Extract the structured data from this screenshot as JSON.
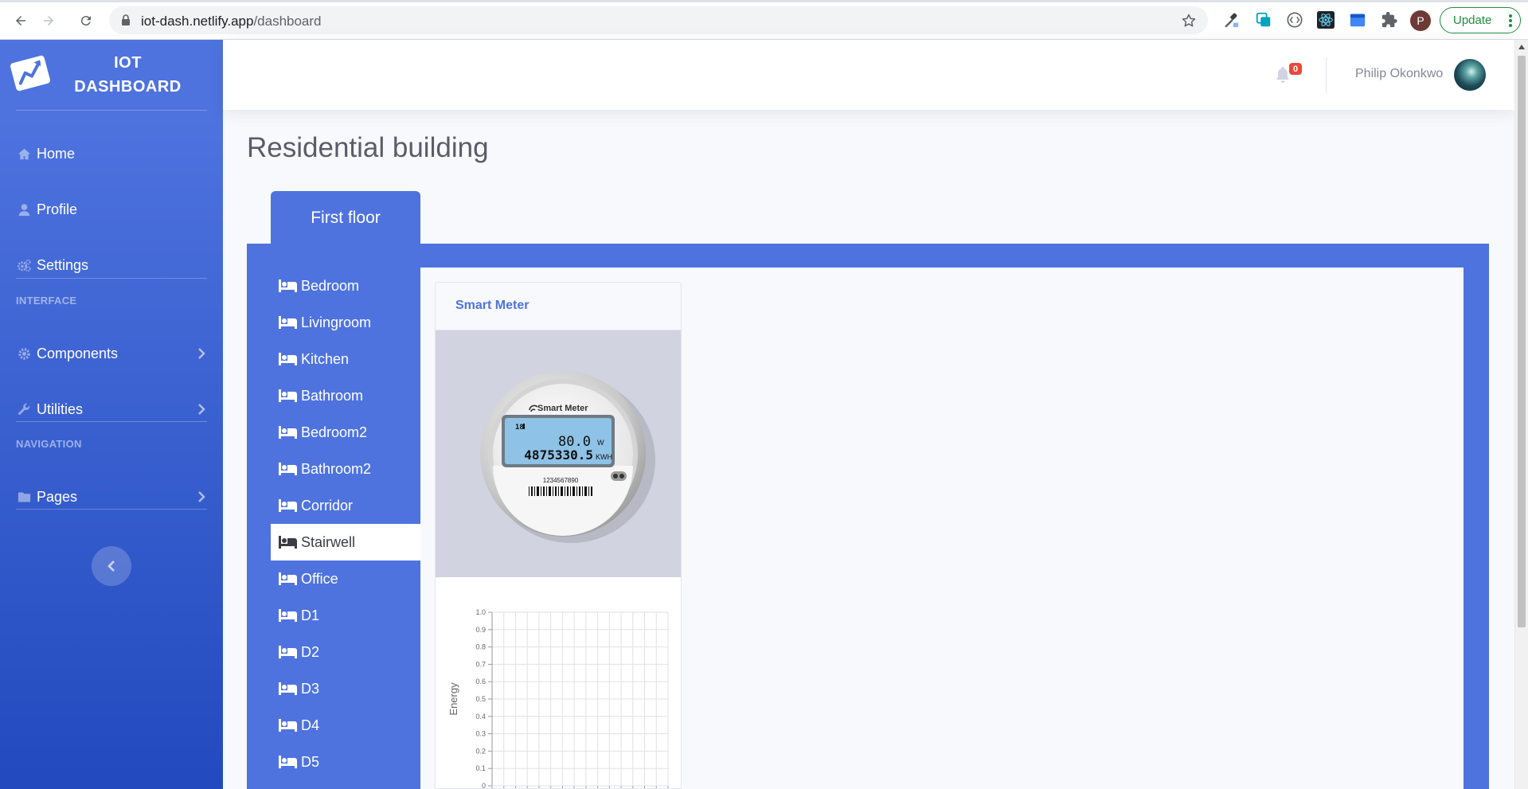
{
  "browser": {
    "url_host": "iot-dash.netlify.app",
    "url_path": "/dashboard",
    "profile_initial": "P",
    "update_label": "Update"
  },
  "sidebar": {
    "brand_line1": "IOT",
    "brand_line2": "DASHBOARD",
    "items_top": [
      {
        "label": "Home",
        "icon": "home-icon"
      },
      {
        "label": "Profile",
        "icon": "user-icon"
      },
      {
        "label": "Settings",
        "icon": "cogs-icon"
      }
    ],
    "heading_interface": "INTERFACE",
    "items_interface": [
      {
        "label": "Components",
        "icon": "cog-icon"
      },
      {
        "label": "Utilities",
        "icon": "wrench-icon"
      }
    ],
    "heading_navigation": "NAVIGATION",
    "items_navigation": [
      {
        "label": "Pages",
        "icon": "folder-icon"
      }
    ]
  },
  "topbar": {
    "alerts_count": "0",
    "user_name": "Philip Okonkwo"
  },
  "page": {
    "title": "Residential building",
    "floor_tab": "First floor",
    "rooms": [
      "Bedroom",
      "Livingroom",
      "Kitchen",
      "Bathroom",
      "Bedroom2",
      "Bathroom2",
      "Corridor",
      "Stairwell",
      "Office",
      "D1",
      "D2",
      "D3",
      "D4",
      "D5"
    ],
    "active_room": "Stairwell"
  },
  "card": {
    "title": "Smart Meter",
    "meter": {
      "brand": "Smart Meter",
      "indicator": "18",
      "power_value": "80.0",
      "power_unit": "W",
      "energy_value": "4875330.5",
      "energy_unit": "KWH",
      "serial": "1234567890"
    }
  },
  "chart_data": {
    "type": "line",
    "ylabel": "Energy",
    "ylim": [
      0,
      1.0
    ],
    "y_ticks": [
      "0",
      "0.1",
      "0.2",
      "0.3",
      "0.4",
      "0.5",
      "0.6",
      "0.7",
      "0.8",
      "0.9",
      "1.0"
    ],
    "series": [],
    "grid": true
  },
  "colors": {
    "primary": "#4e73df",
    "sidebar_gradient_end": "#224abe",
    "badge_danger": "#e74a3b",
    "update_green": "#1e8e3e"
  }
}
